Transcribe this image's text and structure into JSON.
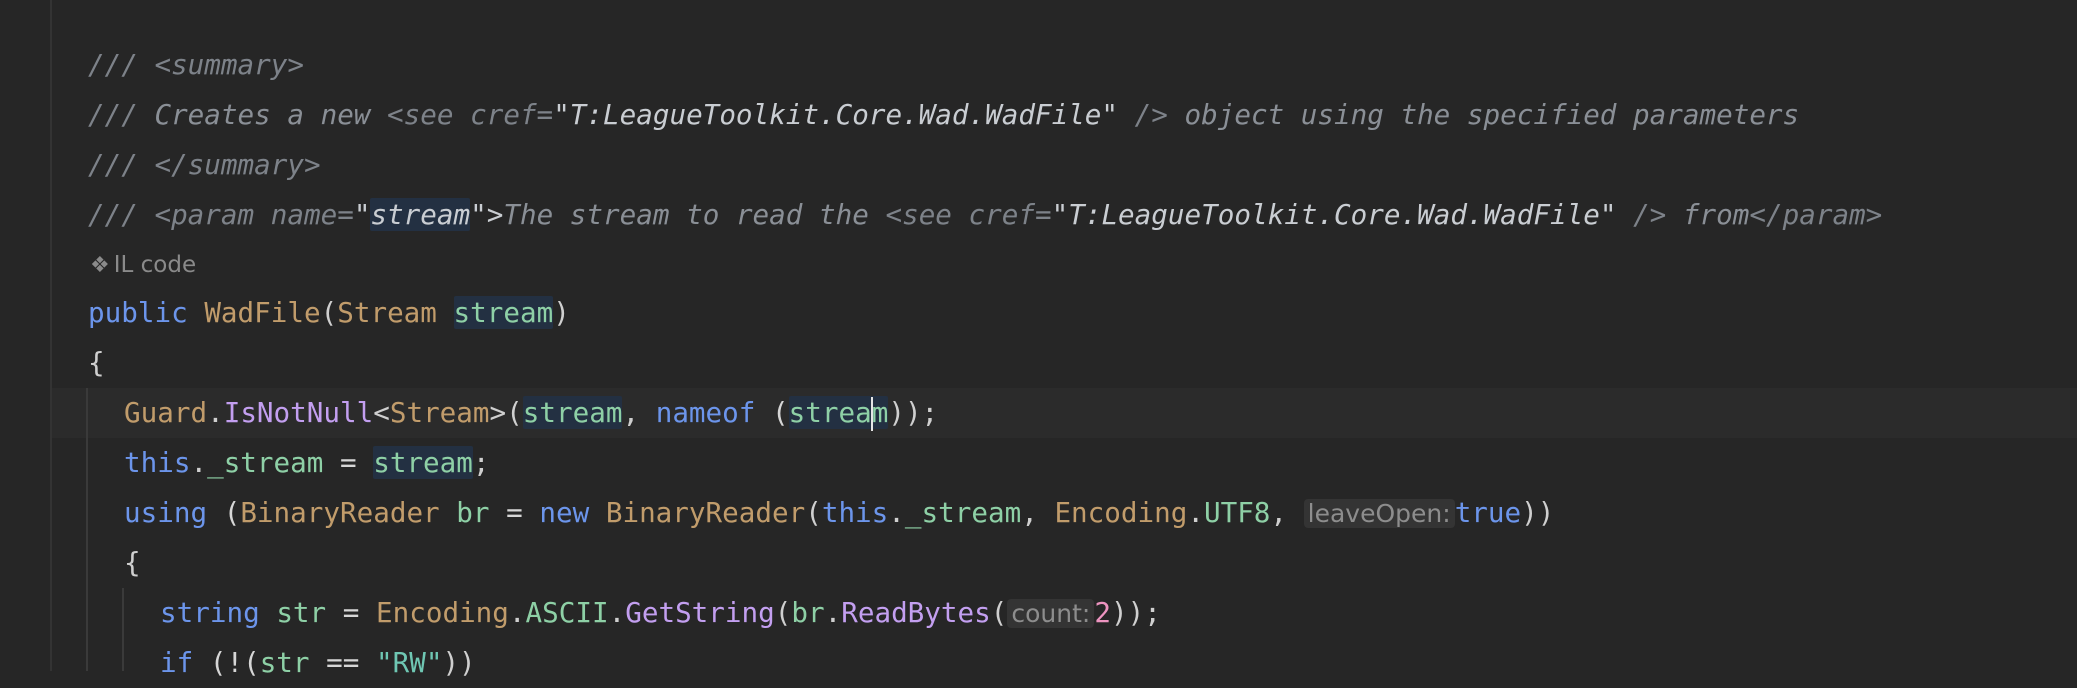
{
  "editor": {
    "doc_comment": {
      "summary_open": "<summary>",
      "creates_prefix": "Creates a new ",
      "see_open": "<see cref=",
      "cref_value": "\"T:LeagueToolkit.Core.Wad.WadFile\"",
      "see_close": " />",
      "creates_suffix": " object using the specified parameters",
      "summary_close": "</summary>",
      "param_open": "<param name=",
      "param_quote_open": "\"",
      "param_name": "stream",
      "param_quote_close": "\">",
      "param_text": "The stream to read the ",
      "param_tail": " from",
      "param_close": "</param>",
      "slashes": "/// "
    },
    "codelens": {
      "icon": "❖",
      "label": "IL code"
    },
    "code": {
      "kw_public": "public",
      "ctor_name": "WadFile",
      "type_stream": "Stream",
      "param_stream": "stream",
      "open_brace": "{",
      "close_paren": ")",
      "guard": "Guard",
      "is_not_null": "IsNotNull",
      "generic_open": "<",
      "generic_close": ">",
      "kw_nameof": "nameof",
      "this_kw": "this",
      "field_stream": "_stream",
      "kw_using": "using",
      "type_binary_reader": "BinaryReader",
      "var_br": "br",
      "kw_new": "new",
      "encoding": "Encoding",
      "utf8": "UTF8",
      "hint_leave_open": "leaveOpen:",
      "kw_true": "true",
      "kw_string": "string",
      "var_str": "str",
      "ascii": "ASCII",
      "get_string": "GetString",
      "read_bytes": "ReadBytes",
      "hint_count": "count:",
      "num_two": "2",
      "kw_if": "if",
      "str_rw": "\"RW\""
    }
  }
}
